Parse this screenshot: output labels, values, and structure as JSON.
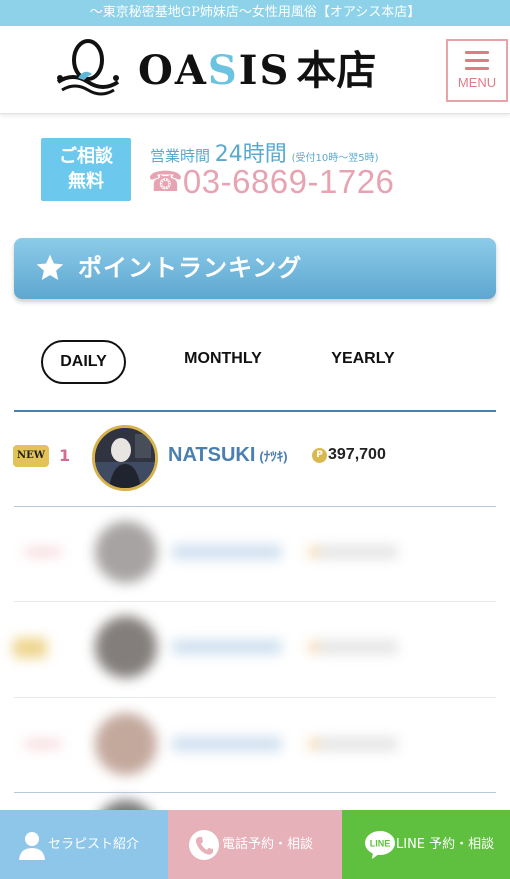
{
  "top_bar": {
    "tagline": "〜東京秘密基地GP姉妹店〜女性用風俗【オアシス本店】"
  },
  "header": {
    "brand_prefix": "OA",
    "brand_accent": "S",
    "brand_suffix": "IS",
    "brand_store": "本店",
    "menu_label": "MENU",
    "icons": {
      "logo": "oasis-logo",
      "menu": "hamburger-icon"
    }
  },
  "contact": {
    "consult_line1": "ご相談",
    "consult_line2": "無料",
    "hours_label": "営業時間",
    "hours_value": "24時間",
    "hours_note": "(受付10時〜翌5時)",
    "phone_icon": "☎",
    "phone_number": "03-6869-1726"
  },
  "ranking": {
    "title": "ポイントランキング",
    "tabs": [
      "DAILY",
      "MONTHLY",
      "YEARLY"
    ],
    "active_tab": "DAILY",
    "entries": [
      {
        "badge": "NEW",
        "rank": "1",
        "name": "NATSUKI",
        "name_kana": "(ﾅﾂｷ)",
        "points_icon": "P",
        "points": "397,700"
      }
    ]
  },
  "bottom_nav": {
    "therapist": "セラピスト紹介",
    "phone": "電話予約・相談",
    "line": "LINE 予約・相談",
    "line_icon_text": "LINE"
  },
  "colors": {
    "top_bar": "#8dd2e8",
    "accent_blue": "#5aa9cf",
    "accent_pink": "#e6a4b3",
    "banner": "#6fb4dc",
    "gold": "#d9b94f",
    "line_green": "#5fbf3f"
  }
}
